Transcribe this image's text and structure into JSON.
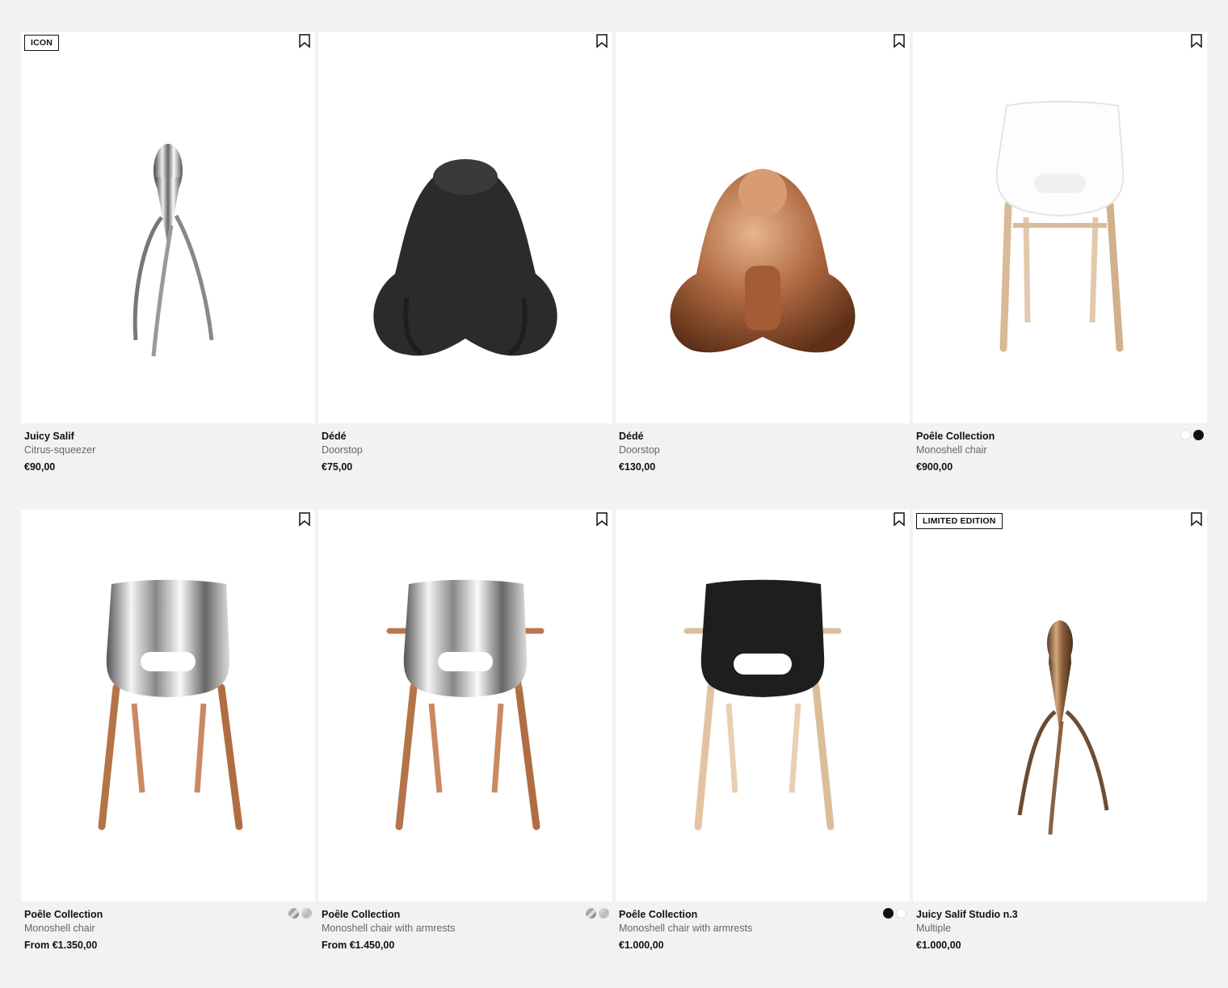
{
  "products": [
    {
      "badge": "ICON",
      "name": "Juicy Salif",
      "subtitle": "Citrus-squeezer",
      "price": "€90,00",
      "swatches": [],
      "image": "chrome-juicer"
    },
    {
      "badge": "",
      "name": "Dédé",
      "subtitle": "Doorstop",
      "price": "€75,00",
      "swatches": [],
      "image": "black-doorstop"
    },
    {
      "badge": "",
      "name": "Dédé",
      "subtitle": "Doorstop",
      "price": "€130,00",
      "swatches": [],
      "image": "copper-doorstop"
    },
    {
      "badge": "",
      "name": "Poêle Collection",
      "subtitle": "Monoshell chair",
      "price": "€900,00",
      "swatches": [
        "white",
        "black"
      ],
      "image": "white-chair"
    },
    {
      "badge": "",
      "name": "Poêle Collection",
      "subtitle": "Monoshell chair",
      "price": "From €1.350,00",
      "swatches": [
        "chrome",
        "silver"
      ],
      "image": "chrome-chair"
    },
    {
      "badge": "",
      "name": "Poêle Collection",
      "subtitle": "Monoshell chair with armrests",
      "price": "From €1.450,00",
      "swatches": [
        "chrome",
        "silver"
      ],
      "image": "chrome-armchair"
    },
    {
      "badge": "",
      "name": "Poêle Collection",
      "subtitle": "Monoshell chair with armrests",
      "price": "€1.000,00",
      "swatches": [
        "black",
        "white"
      ],
      "image": "black-armchair"
    },
    {
      "badge": "LIMITED EDITION",
      "name": "Juicy Salif Studio n.3",
      "subtitle": "Multiple",
      "price": "€1.000,00",
      "swatches": [],
      "image": "bronze-juicer"
    }
  ],
  "icons": {
    "bookmark": "bookmark-icon"
  },
  "colors": {
    "background": "#f2f2f2",
    "card": "#ffffff",
    "text": "#111111",
    "muted": "#666666"
  }
}
